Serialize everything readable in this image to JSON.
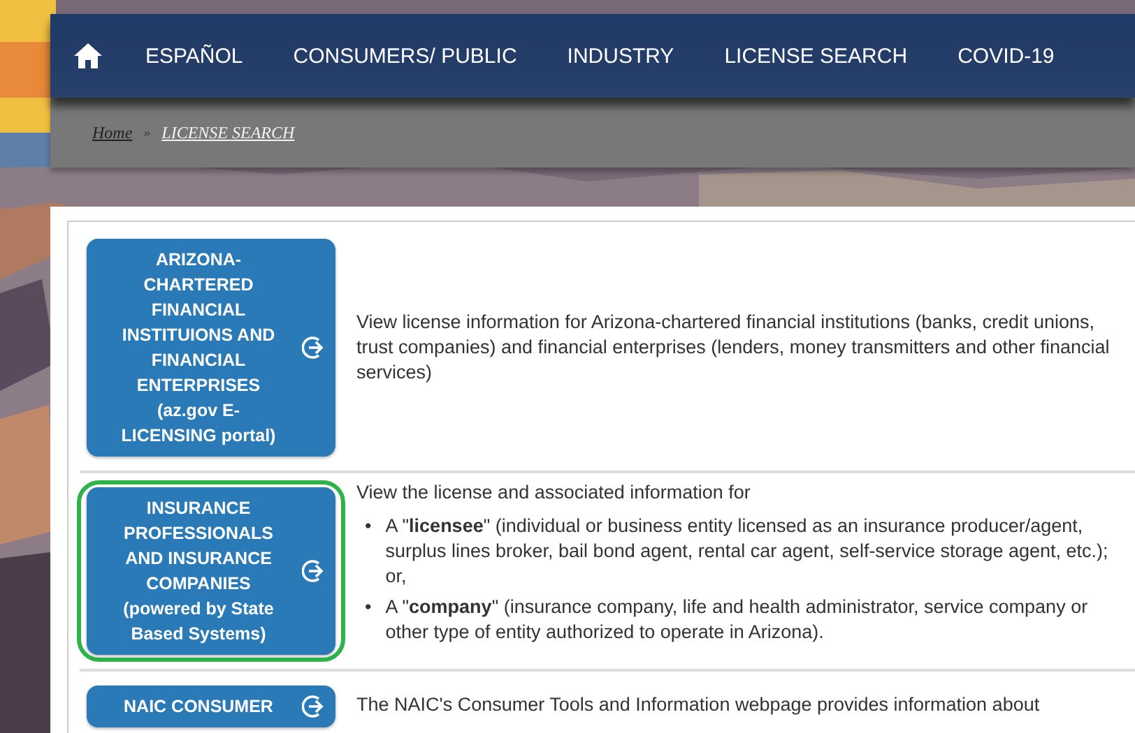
{
  "nav": {
    "items": [
      {
        "label": "ESPAÑOL"
      },
      {
        "label": "CONSUMERS/ PUBLIC"
      },
      {
        "label": "INDUSTRY"
      },
      {
        "label": "LICENSE SEARCH"
      },
      {
        "label": "COVID-19"
      }
    ]
  },
  "breadcrumb": [
    {
      "label": "Home",
      "current": false
    },
    {
      "label": "LICENSE SEARCH",
      "current": true
    }
  ],
  "breadcrumb_separator": "»",
  "bullet_marker": "•",
  "rows": [
    {
      "button": [
        "ARIZONA-",
        "CHARTERED",
        "FINANCIAL",
        "INSTITUIONS AND",
        "FINANCIAL",
        "ENTERPRISES",
        "(az.gov E-",
        "LICENSING portal)"
      ],
      "highlighted": false,
      "description": "View license information for Arizona-chartered financial institutions (banks, credit unions, trust companies) and financial enterprises (lenders, money transmitters and other financial services)",
      "bullets": []
    },
    {
      "button": [
        "INSURANCE",
        "PROFESSIONALS",
        "AND INSURANCE",
        "COMPANIES",
        "(powered by State",
        "Based Systems)"
      ],
      "highlighted": true,
      "description": "View the license and associated information for",
      "bullets": [
        "A \"**licensee**\" (individual or business entity licensed as an insurance producer/agent, surplus lines broker, bail bond agent, rental car agent, self-service storage agent, etc.); or,",
        "A \"**company**\" (insurance company, life and health administrator, service company or other type of entity authorized to operate in Arizona)."
      ]
    },
    {
      "button": [
        "NAIC CONSUMER"
      ],
      "highlighted": false,
      "description": "The NAIC's Consumer Tools and Information webpage provides information about",
      "bullets": []
    }
  ]
}
